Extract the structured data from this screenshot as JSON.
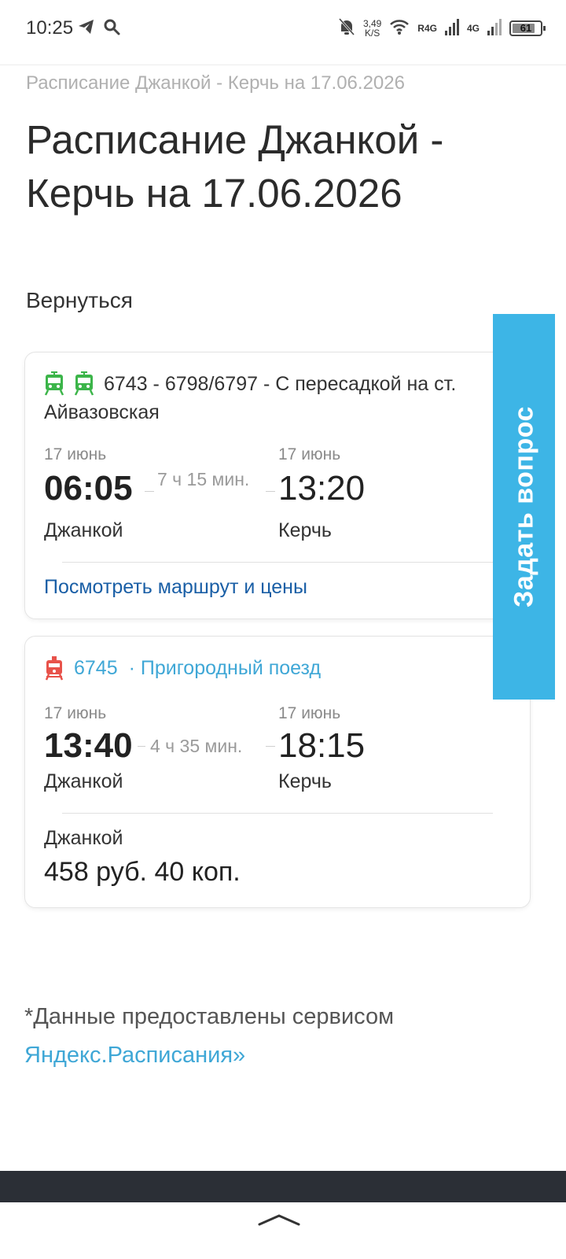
{
  "status_bar": {
    "time": "10:25",
    "speed_value": "3,49",
    "speed_unit": "K/S",
    "net1": "R4G",
    "net2": "4G",
    "battery": "61"
  },
  "breadcrumb": "Расписание Джанкой - Керчь на 17.06.2026",
  "page_title": "Расписание Джанкой - Керчь на 17.06.2026",
  "back_label": "Вернуться",
  "ask_button": "Задать вопрос",
  "trips": [
    {
      "number": "6743 - 6798/6797 - С пересадкой на ст.",
      "subtitle": "Айвазовская",
      "dep_date": "17 июнь",
      "dep_time": "06:05",
      "dep_station": "Джанкой",
      "duration": "7 ч 15 мин.",
      "arr_date": "17 июнь",
      "arr_time": "13:20",
      "arr_station": "Керчь",
      "link": "Посмотреть маршрут и цены"
    },
    {
      "number": "6745",
      "type": "· Пригородный поезд",
      "dep_date": "17 июнь",
      "dep_time": "13:40",
      "dep_station": "Джанкой",
      "duration": "4 ч 35 мин.",
      "arr_date": "17 июнь",
      "arr_time": "18:15",
      "arr_station": "Керчь",
      "price_label": "Джанкой",
      "price": "458 руб. 40 коп."
    }
  ],
  "footnote": {
    "text": "*Данные предоставлены сервисом",
    "link": "Яндекс.Расписания»"
  },
  "colors": {
    "accent": "#3db5e6",
    "link": "#1a5fa6",
    "train_green": "#3cb54a",
    "train_red": "#e8524a"
  }
}
